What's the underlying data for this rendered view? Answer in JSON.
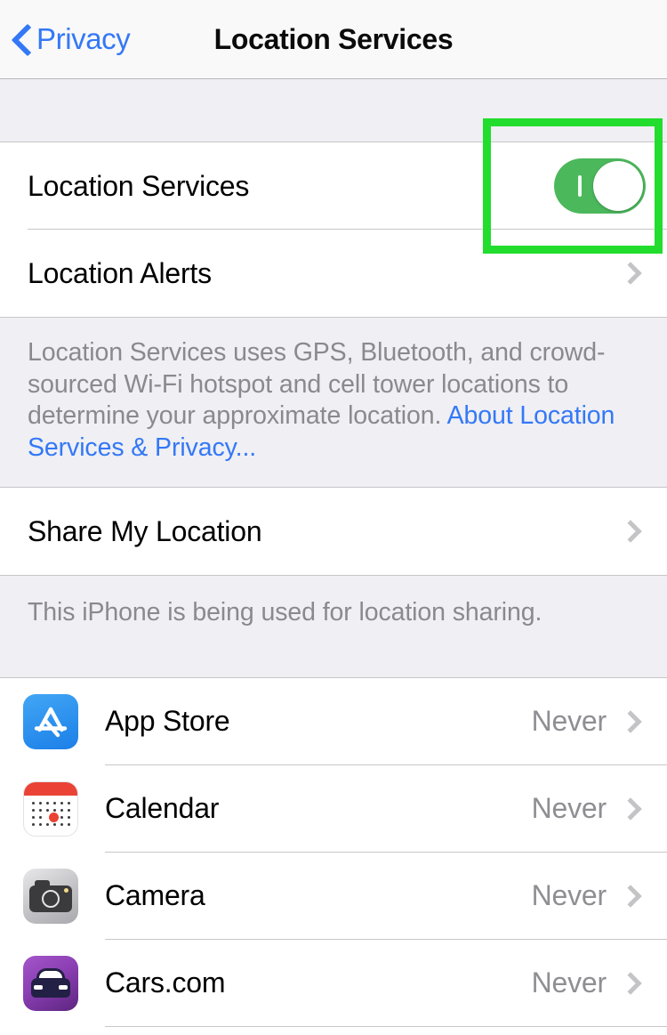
{
  "navbar": {
    "back_label": "Privacy",
    "back_icon": "chevron-left-icon",
    "title": "Location Services"
  },
  "sections": {
    "main": {
      "location_services_row": {
        "label": "Location Services",
        "toggle_state": "on",
        "toggle_color": "#4cb85c"
      },
      "location_alerts_row": {
        "label": "Location Alerts",
        "chevron": "chevron-right-icon"
      },
      "footer_text": "Location Services uses GPS, Bluetooth, and crowd-sourced Wi-Fi hotspot and cell tower locations to determine your approximate location. ",
      "footer_link": "About Location Services & Privacy..."
    },
    "share": {
      "share_my_location_row": {
        "label": "Share My Location",
        "chevron": "chevron-right-icon"
      },
      "footer_text": "This iPhone is being used for location sharing."
    },
    "apps": {
      "items": [
        {
          "name": "App Store",
          "value": "Never",
          "icon": "app-store-icon"
        },
        {
          "name": "Calendar",
          "value": "Never",
          "icon": "calendar-icon"
        },
        {
          "name": "Camera",
          "value": "Never",
          "icon": "camera-icon"
        },
        {
          "name": "Cars.com",
          "value": "Never",
          "icon": "cars-com-icon"
        }
      ]
    }
  },
  "annotation": {
    "highlight_box": {
      "target": "location-services-toggle",
      "color": "#22dd2e"
    }
  }
}
